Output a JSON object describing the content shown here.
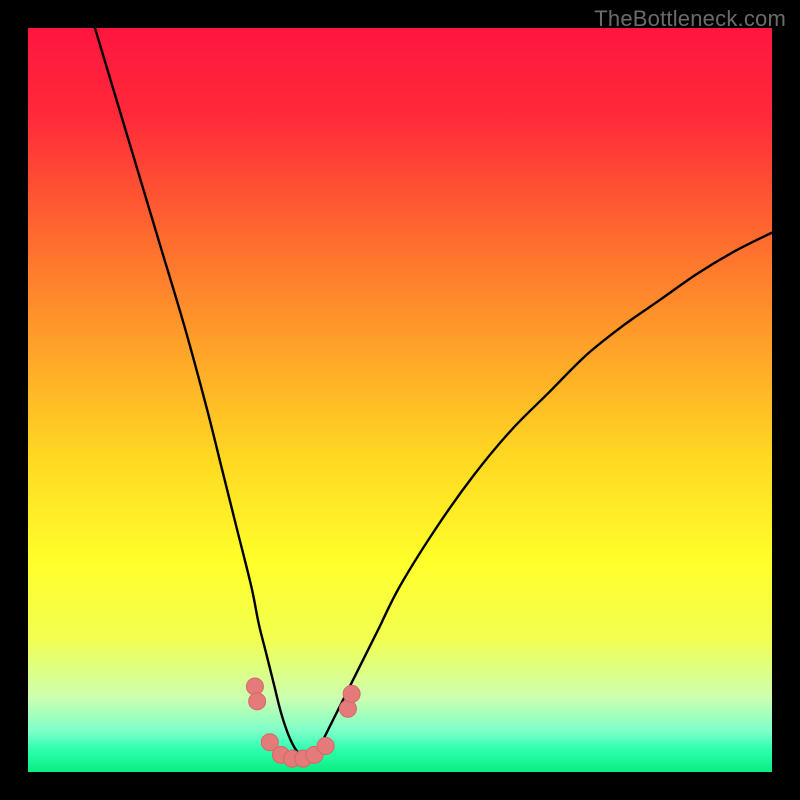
{
  "watermark": {
    "text": "TheBottleneck.com"
  },
  "colors": {
    "gradient_stops": [
      {
        "offset": 0.0,
        "color": "#ff163f"
      },
      {
        "offset": 0.12,
        "color": "#ff2a3a"
      },
      {
        "offset": 0.28,
        "color": "#ff6a2f"
      },
      {
        "offset": 0.44,
        "color": "#ffa628"
      },
      {
        "offset": 0.58,
        "color": "#ffd922"
      },
      {
        "offset": 0.72,
        "color": "#ffff2a"
      },
      {
        "offset": 0.82,
        "color": "#f2ff50"
      },
      {
        "offset": 0.9,
        "color": "#ccffb0"
      },
      {
        "offset": 0.945,
        "color": "#7dffc9"
      },
      {
        "offset": 0.97,
        "color": "#2dffaf"
      },
      {
        "offset": 1.0,
        "color": "#0aed80"
      }
    ],
    "curve_stroke": "#000000",
    "marker_fill": "#e47a79",
    "marker_stroke": "#d46868"
  },
  "chart_data": {
    "type": "line",
    "title": "",
    "xlabel": "",
    "ylabel": "",
    "xlim": [
      0,
      100
    ],
    "ylim": [
      0,
      100
    ],
    "series": [
      {
        "name": "bottleneck-curve",
        "x": [
          9,
          12,
          15,
          18,
          21,
          24,
          26,
          28,
          30,
          31,
          32,
          33,
          34,
          35,
          36,
          37,
          38,
          39,
          40,
          42,
          44,
          47,
          50,
          55,
          60,
          65,
          70,
          75,
          80,
          85,
          90,
          95,
          100
        ],
        "y": [
          100,
          90,
          80,
          70,
          60,
          49,
          41,
          33,
          25,
          20,
          16,
          12,
          8,
          5,
          3,
          2,
          2,
          3,
          5,
          9,
          13,
          19,
          25,
          33,
          40,
          46,
          51,
          56,
          60,
          63.5,
          67,
          70,
          72.5
        ]
      }
    ],
    "markers": {
      "name": "highlighted-points",
      "points": [
        {
          "x": 30.5,
          "y": 11.5
        },
        {
          "x": 30.8,
          "y": 9.5
        },
        {
          "x": 32.5,
          "y": 4.0
        },
        {
          "x": 34.0,
          "y": 2.3
        },
        {
          "x": 35.5,
          "y": 1.8
        },
        {
          "x": 37.0,
          "y": 1.8
        },
        {
          "x": 38.5,
          "y": 2.3
        },
        {
          "x": 40.0,
          "y": 3.5
        },
        {
          "x": 43.0,
          "y": 8.5
        },
        {
          "x": 43.5,
          "y": 10.5
        }
      ]
    }
  }
}
